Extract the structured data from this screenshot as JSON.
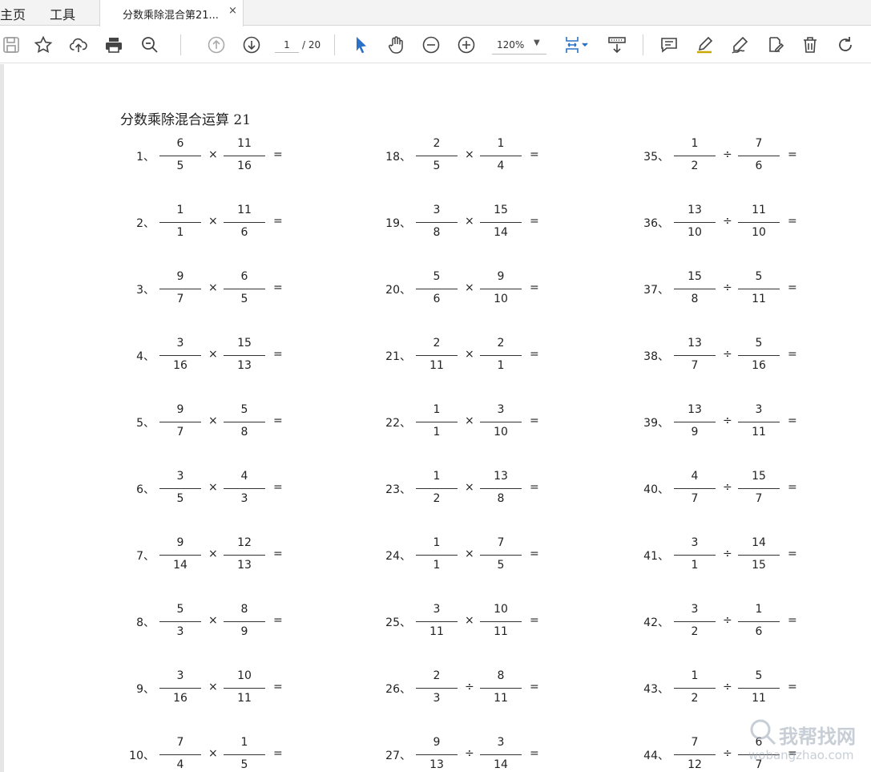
{
  "tabs": {
    "home": "主页",
    "tools": "工具",
    "doc": "分数乘除混合第21...",
    "close": "×"
  },
  "toolbar": {
    "page_current": "1",
    "page_total": "/ 20",
    "zoom": "120%",
    "icons": [
      "save-icon",
      "star-icon",
      "upload-icon",
      "print-icon",
      "search-zoom-icon",
      "page-up-icon",
      "page-down-icon",
      "select-cursor-icon",
      "hand-icon",
      "zoom-out-icon",
      "zoom-in-icon",
      "fit-page-icon",
      "scroll-mode-icon",
      "comment-icon",
      "highlight-icon",
      "sign-icon",
      "edit-icon",
      "delete-icon",
      "rotate-icon"
    ]
  },
  "document": {
    "title": "分数乘除混合运算 21",
    "equals": "=",
    "columns": [
      [
        {
          "n": "1、",
          "a": [
            "6",
            "5"
          ],
          "op": "×",
          "b": [
            "11",
            "16"
          ]
        },
        {
          "n": "2、",
          "a": [
            "1",
            "1"
          ],
          "op": "×",
          "b": [
            "11",
            "6"
          ]
        },
        {
          "n": "3、",
          "a": [
            "9",
            "7"
          ],
          "op": "×",
          "b": [
            "6",
            "5"
          ]
        },
        {
          "n": "4、",
          "a": [
            "3",
            "16"
          ],
          "op": "×",
          "b": [
            "15",
            "13"
          ]
        },
        {
          "n": "5、",
          "a": [
            "9",
            "7"
          ],
          "op": "×",
          "b": [
            "5",
            "8"
          ]
        },
        {
          "n": "6、",
          "a": [
            "3",
            "5"
          ],
          "op": "×",
          "b": [
            "4",
            "3"
          ]
        },
        {
          "n": "7、",
          "a": [
            "9",
            "14"
          ],
          "op": "×",
          "b": [
            "12",
            "13"
          ]
        },
        {
          "n": "8、",
          "a": [
            "5",
            "3"
          ],
          "op": "×",
          "b": [
            "8",
            "9"
          ]
        },
        {
          "n": "9、",
          "a": [
            "3",
            "16"
          ],
          "op": "×",
          "b": [
            "10",
            "11"
          ]
        },
        {
          "n": "10、",
          "a": [
            "7",
            "4"
          ],
          "op": "×",
          "b": [
            "1",
            "5"
          ]
        }
      ],
      [
        {
          "n": "18、",
          "a": [
            "2",
            "5"
          ],
          "op": "×",
          "b": [
            "1",
            "4"
          ]
        },
        {
          "n": "19、",
          "a": [
            "3",
            "8"
          ],
          "op": "×",
          "b": [
            "15",
            "14"
          ]
        },
        {
          "n": "20、",
          "a": [
            "5",
            "6"
          ],
          "op": "×",
          "b": [
            "9",
            "10"
          ]
        },
        {
          "n": "21、",
          "a": [
            "2",
            "11"
          ],
          "op": "×",
          "b": [
            "2",
            "1"
          ]
        },
        {
          "n": "22、",
          "a": [
            "1",
            "1"
          ],
          "op": "×",
          "b": [
            "3",
            "10"
          ]
        },
        {
          "n": "23、",
          "a": [
            "1",
            "2"
          ],
          "op": "×",
          "b": [
            "13",
            "8"
          ]
        },
        {
          "n": "24、",
          "a": [
            "1",
            "1"
          ],
          "op": "×",
          "b": [
            "7",
            "5"
          ]
        },
        {
          "n": "25、",
          "a": [
            "3",
            "11"
          ],
          "op": "×",
          "b": [
            "10",
            "11"
          ]
        },
        {
          "n": "26、",
          "a": [
            "2",
            "3"
          ],
          "op": "÷",
          "b": [
            "8",
            "11"
          ]
        },
        {
          "n": "27、",
          "a": [
            "9",
            "13"
          ],
          "op": "÷",
          "b": [
            "3",
            "14"
          ]
        }
      ],
      [
        {
          "n": "35、",
          "a": [
            "1",
            "2"
          ],
          "op": "÷",
          "b": [
            "7",
            "6"
          ]
        },
        {
          "n": "36、",
          "a": [
            "13",
            "10"
          ],
          "op": "÷",
          "b": [
            "11",
            "10"
          ]
        },
        {
          "n": "37、",
          "a": [
            "15",
            "8"
          ],
          "op": "÷",
          "b": [
            "5",
            "11"
          ]
        },
        {
          "n": "38、",
          "a": [
            "13",
            "7"
          ],
          "op": "÷",
          "b": [
            "5",
            "16"
          ]
        },
        {
          "n": "39、",
          "a": [
            "13",
            "9"
          ],
          "op": "÷",
          "b": [
            "3",
            "11"
          ]
        },
        {
          "n": "40、",
          "a": [
            "4",
            "7"
          ],
          "op": "÷",
          "b": [
            "15",
            "7"
          ]
        },
        {
          "n": "41、",
          "a": [
            "3",
            "1"
          ],
          "op": "÷",
          "b": [
            "14",
            "15"
          ]
        },
        {
          "n": "42、",
          "a": [
            "3",
            "2"
          ],
          "op": "÷",
          "b": [
            "1",
            "6"
          ]
        },
        {
          "n": "43、",
          "a": [
            "1",
            "2"
          ],
          "op": "÷",
          "b": [
            "5",
            "11"
          ]
        },
        {
          "n": "44、",
          "a": [
            "7",
            "12"
          ],
          "op": "÷",
          "b": [
            "6",
            "7"
          ]
        }
      ]
    ]
  },
  "watermark": {
    "cn": "我帮找网",
    "en": "wobangzhao.com"
  }
}
